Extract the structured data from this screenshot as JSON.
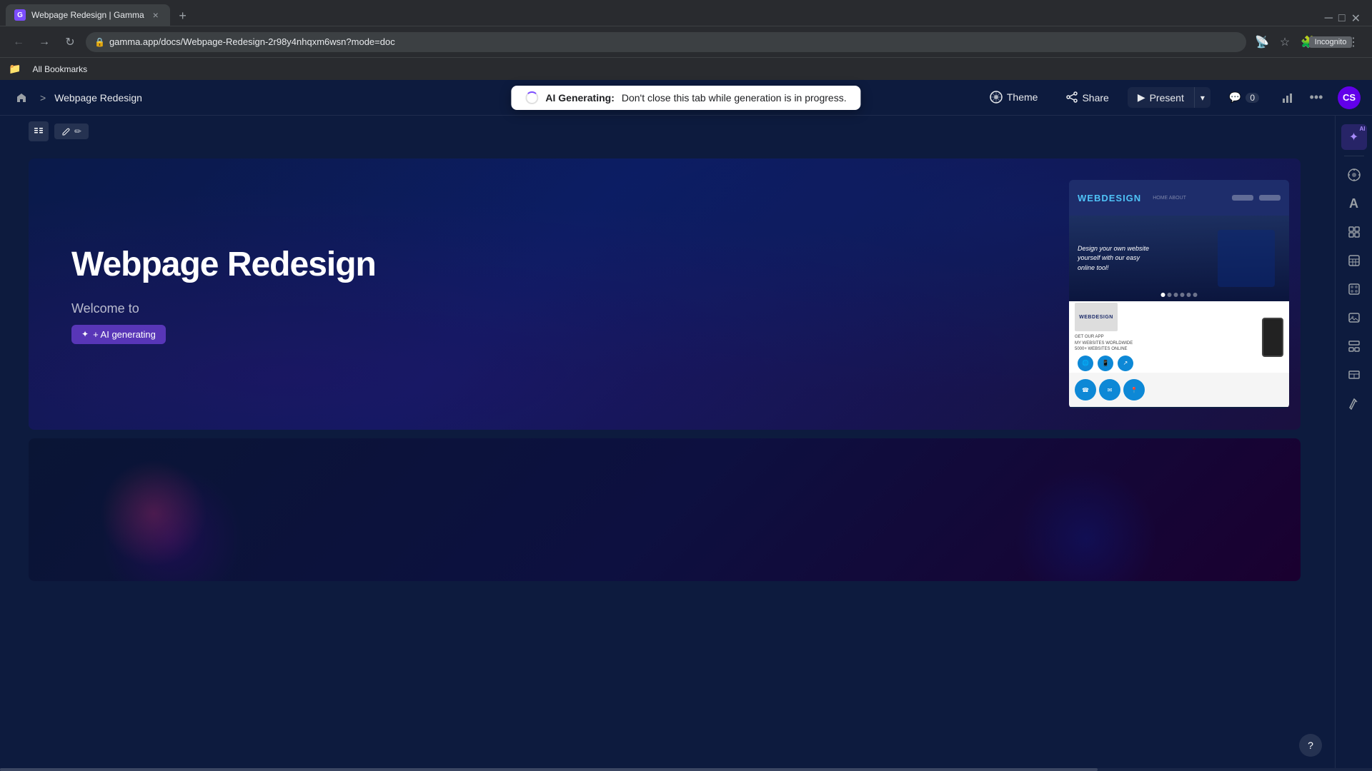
{
  "browser": {
    "tab_title": "Webpage Redesign | Gamma",
    "tab_favicon": "G",
    "close_icon": "×",
    "new_tab_icon": "+",
    "back_icon": "←",
    "forward_icon": "→",
    "refresh_icon": "↻",
    "address": "gamma.app/docs/Webpage-Redesign-2r98y4nhqxm6wsn?mode=doc",
    "incognito_label": "Incognito",
    "bookmarks_label": "All Bookmarks"
  },
  "toolbar": {
    "home_icon": "🏠",
    "breadcrumb_sep": ">",
    "breadcrumb_item": "Webpage Redesign",
    "ai_generating_bold": "AI Generating:",
    "ai_generating_text": "Don't close this tab while generation is in progress.",
    "theme_label": "Theme",
    "share_label": "Share",
    "present_label": "Present",
    "present_arrow": "▾",
    "comment_icon": "💬",
    "comment_count": "0",
    "more_icon": "•••",
    "chart_icon": "📊",
    "avatar_text": "CS"
  },
  "slide": {
    "title": "Webpage Redesign",
    "subtitle": "Welcome to",
    "ai_badge": "+ AI generating",
    "menu_icon": "⋮⋮",
    "edit_icon": "✏"
  },
  "mockup": {
    "logo_text": "WEB",
    "logo_accent": "DESIGN",
    "hero_line1": "Design your own website",
    "hero_line2": "yourself with our easy",
    "hero_line3": "online tool!",
    "device_text": "WEBDESIGN"
  },
  "right_sidebar": {
    "ai_icon": "✦",
    "ai_badge": "AI",
    "layers_icon": "◉",
    "text_icon": "A",
    "cards_icon": "▦",
    "table_icon": "⊞",
    "palette_icon": "◈",
    "image_icon": "🖼",
    "grid_icon": "⊟",
    "layout_icon": "▭",
    "pen_icon": "✏"
  },
  "help": {
    "icon": "?"
  }
}
